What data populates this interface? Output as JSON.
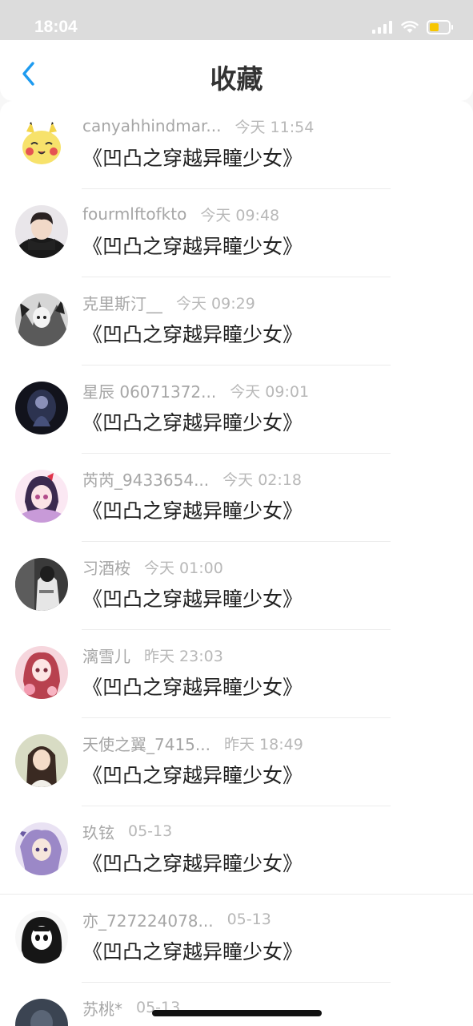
{
  "status_bar": {
    "time": "18:04",
    "icons": [
      "signal-icon",
      "wifi-icon",
      "battery-icon"
    ],
    "battery_color": "#f7c600"
  },
  "nav": {
    "back_icon": "chevron-left-icon",
    "title": "收藏",
    "accent": "#1e9bf0"
  },
  "favorites": [
    {
      "username": "canyahhindmar...",
      "time": "今天 11:54",
      "book": "《凹凸之穿越异瞳少女》",
      "avatar_color": "#f7e26b"
    },
    {
      "username": "fourmlftofkto",
      "time": "今天 09:48",
      "book": "《凹凸之穿越异瞳少女》",
      "avatar_color": "#2b2b2b"
    },
    {
      "username": "克里斯汀__",
      "time": "今天 09:29",
      "book": "《凹凸之穿越异瞳少女》",
      "avatar_color": "#9a9a9a"
    },
    {
      "username": "星辰 06071372...",
      "time": "今天 09:01",
      "book": "《凹凸之穿越异瞳少女》",
      "avatar_color": "#1a1c2a"
    },
    {
      "username": "芮芮_9433654...",
      "time": "今天 02:18",
      "book": "《凹凸之穿越异瞳少女》",
      "avatar_color": "#d8a8d8"
    },
    {
      "username": "习酒桉",
      "time": "今天 01:00",
      "book": "《凹凸之穿越异瞳少女》",
      "avatar_color": "#3a3a3a"
    },
    {
      "username": "漓雪儿",
      "time": "昨天 23:03",
      "book": "《凹凸之穿越异瞳少女》",
      "avatar_color": "#e69aa8"
    },
    {
      "username": "天使之翼_7415...",
      "time": "昨天 18:49",
      "book": "《凹凸之穿越异瞳少女》",
      "avatar_color": "#cfc3b4"
    },
    {
      "username": "玖铉",
      "time": "05-13",
      "book": "《凹凸之穿越异瞳少女》",
      "avatar_color": "#b9a8d6"
    },
    {
      "username": "亦_727224078...",
      "time": "05-13",
      "book": "《凹凸之穿越异瞳少女》",
      "avatar_color": "#e8e8e8"
    },
    {
      "username": "苏桃*",
      "time": "05-13",
      "book": "",
      "avatar_color": "#3b4452"
    }
  ]
}
